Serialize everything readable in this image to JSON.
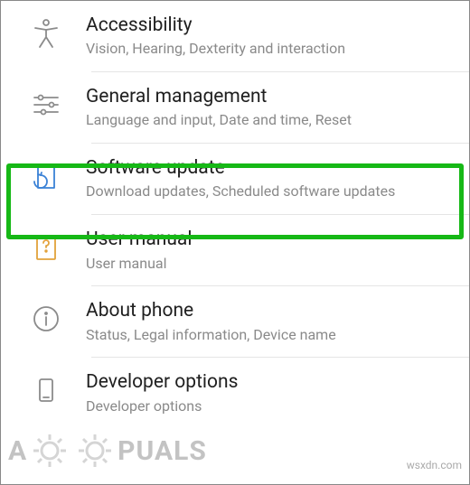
{
  "settings": [
    {
      "id": "accessibility",
      "title": "Accessibility",
      "subtitle": "Vision, Hearing, Dexterity and interaction",
      "iconColor": "#8b8b8b"
    },
    {
      "id": "general-management",
      "title": "General management",
      "subtitle": "Language and input, Date and time, Reset",
      "iconColor": "#8b8b8b"
    },
    {
      "id": "software-update",
      "title": "Software update",
      "subtitle": "Download updates, Scheduled software updates",
      "iconColor": "#3b82d6"
    },
    {
      "id": "user-manual",
      "title": "User manual",
      "subtitle": "User manual",
      "iconColor": "#e2a23b"
    },
    {
      "id": "about-phone",
      "title": "About phone",
      "subtitle": "Status, Legal information, Device name",
      "iconColor": "#8b8b8b"
    },
    {
      "id": "developer-options",
      "title": "Developer options",
      "subtitle": "Developer options",
      "iconColor": "#8b8b8b"
    }
  ],
  "highlightIndex": 2,
  "watermark": {
    "leftPrefix": "A",
    "leftSuffix": "PUALS",
    "right": "wsxdn.com"
  }
}
